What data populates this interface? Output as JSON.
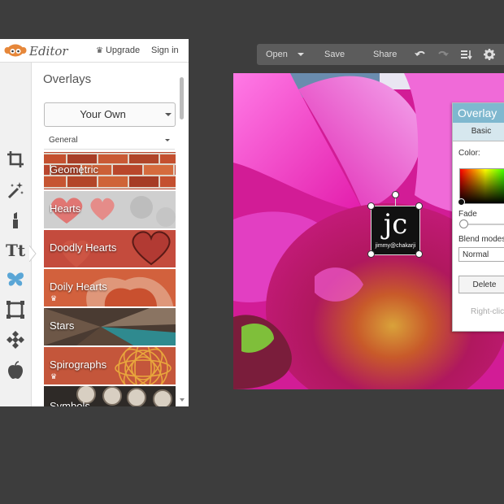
{
  "app": {
    "title": "Editor",
    "upgrade_label": "Upgrade",
    "signin_label": "Sign in"
  },
  "tools": [
    {
      "name": "crop-icon"
    },
    {
      "name": "magic-wand-icon"
    },
    {
      "name": "lipstick-icon"
    },
    {
      "name": "text-icon",
      "glyph": "Tt"
    },
    {
      "name": "butterfly-icon"
    },
    {
      "name": "frame-icon"
    },
    {
      "name": "texture-icon"
    },
    {
      "name": "apple-icon"
    }
  ],
  "overlays": {
    "title": "Overlays",
    "your_own_label": "Your Own",
    "category": "General",
    "items": [
      {
        "label": "Geometric",
        "premium": false
      },
      {
        "label": "Hearts",
        "premium": false
      },
      {
        "label": "Doodly Hearts",
        "premium": false
      },
      {
        "label": "Doily Hearts",
        "premium": true
      },
      {
        "label": "Stars",
        "premium": false
      },
      {
        "label": "Spirographs",
        "premium": true
      },
      {
        "label": "Symbols",
        "premium": false
      }
    ]
  },
  "toolbar": {
    "open_label": "Open",
    "save_label": "Save",
    "share_label": "Share"
  },
  "canvas": {
    "overlay_glyph": "jc",
    "overlay_caption": "jimmy@chakarji"
  },
  "dialog": {
    "title": "Overlay",
    "tab_basic": "Basic",
    "color_label": "Color:",
    "fade_label": "Fade",
    "blend_label": "Blend modes",
    "blend_value": "Normal",
    "delete_label": "Delete",
    "hint": "Right-click"
  },
  "colors": {
    "accent": "#7fb8cf",
    "butterfly_active": "#5aa6d6"
  }
}
